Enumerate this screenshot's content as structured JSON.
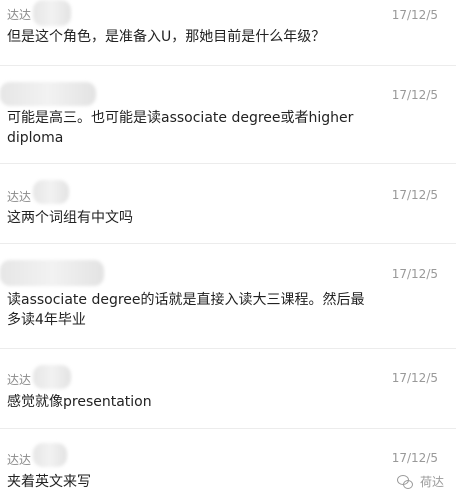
{
  "comments": [
    {
      "username": "达达",
      "timestamp": "17/12/5",
      "text": "但是这个角色，是准备入U，那她目前是什么年级？"
    },
    {
      "username": "",
      "timestamp": "17/12/5",
      "text": "可能是高三。也可能是读associate degree或者higher diploma"
    },
    {
      "username": "达达",
      "timestamp": "17/12/5",
      "text": "这两个词组有中文吗"
    },
    {
      "username": "",
      "timestamp": "17/12/5",
      "text": "读associate degree的话就是直接入读大三课程。然后最多读4年毕业"
    },
    {
      "username": "达达",
      "timestamp": "17/12/5",
      "text": "感觉就像presentation"
    },
    {
      "username": "达达",
      "timestamp": "17/12/5",
      "text": "夹着英文来写"
    }
  ],
  "watermark": {
    "text": "荷达",
    "icon": "wechat-icon"
  }
}
